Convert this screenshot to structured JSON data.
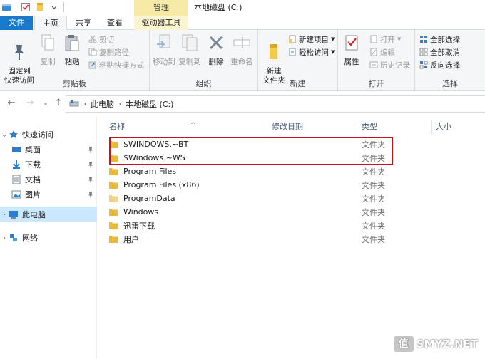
{
  "titlebar": {
    "context_group_label": "管理",
    "window_title": "本地磁盘 (C:)"
  },
  "tabs": {
    "file": "文件",
    "home": "主页",
    "share": "共享",
    "view": "查看",
    "drive_tools": "驱动器工具"
  },
  "ribbon": {
    "clipboard": {
      "label": "剪贴板",
      "pin_quick": "固定到\n快速访问",
      "copy": "复制",
      "paste": "粘贴",
      "cut": "剪切",
      "copy_path": "复制路径",
      "paste_shortcut": "粘贴快捷方式"
    },
    "organize": {
      "label": "组织",
      "move_to": "移动到",
      "copy_to": "复制到",
      "delete": "删除",
      "rename": "重命名"
    },
    "new": {
      "label": "新建",
      "new_folder": "新建\n文件夹",
      "new_item": "新建项目",
      "easy_access": "轻松访问"
    },
    "open": {
      "label": "打开",
      "properties": "属性",
      "open": "打开",
      "edit": "编辑",
      "history": "历史记录"
    },
    "select": {
      "label": "选择",
      "select_all": "全部选择",
      "select_none": "全部取消",
      "invert": "反向选择"
    }
  },
  "address": {
    "crumbs": [
      "此电脑",
      "本地磁盘 (C:)"
    ]
  },
  "navpane": {
    "quick_access": "快速访问",
    "desktop": "桌面",
    "downloads": "下载",
    "documents": "文档",
    "pictures": "图片",
    "this_pc": "此电脑",
    "network": "网络"
  },
  "columns": {
    "name": "名称",
    "modified": "修改日期",
    "type": "类型",
    "size": "大小"
  },
  "files": [
    {
      "name": "$WINDOWS.~BT",
      "type": "文件夹"
    },
    {
      "name": "$Windows.~WS",
      "type": "文件夹"
    },
    {
      "name": "Program Files",
      "type": "文件夹"
    },
    {
      "name": "Program Files (x86)",
      "type": "文件夹"
    },
    {
      "name": "ProgramData",
      "type": "文件夹"
    },
    {
      "name": "Windows",
      "type": "文件夹"
    },
    {
      "name": "迅雷下载",
      "type": "文件夹"
    },
    {
      "name": "用户",
      "type": "文件夹"
    }
  ],
  "watermark": {
    "badge": "值",
    "text": "SMYZ.NET"
  },
  "colors": {
    "file_tab": "#1979ca",
    "selection": "#cce8ff",
    "context_tab": "#f7e9a6",
    "highlight_box": "#c3141e",
    "folder": "#e8b93c"
  }
}
